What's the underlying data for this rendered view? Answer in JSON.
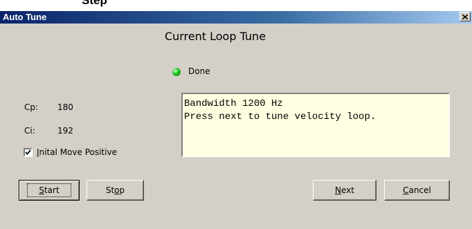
{
  "background_caption": "Step",
  "window": {
    "title": "Auto Tune",
    "heading": "Current Loop Tune"
  },
  "status": {
    "led_color": "#1cc51c",
    "text": "Done"
  },
  "params": {
    "cp_label": "Cp:",
    "cp_value": "180",
    "ci_label": "Ci:",
    "ci_value": "192"
  },
  "message": {
    "line1": "Bandwidth 1200 Hz",
    "line2": "Press next to tune velocity loop."
  },
  "checkbox": {
    "label_mnemonic": "I",
    "label_rest": "nital Move Positive",
    "checked": true
  },
  "buttons": {
    "start_mnemonic": "S",
    "start_rest": "tart",
    "stop_pre": "St",
    "stop_mnemonic": "o",
    "stop_post": "p",
    "next_mnemonic": "N",
    "next_rest": "ext",
    "cancel_mnemonic": "C",
    "cancel_rest": "ancel"
  }
}
